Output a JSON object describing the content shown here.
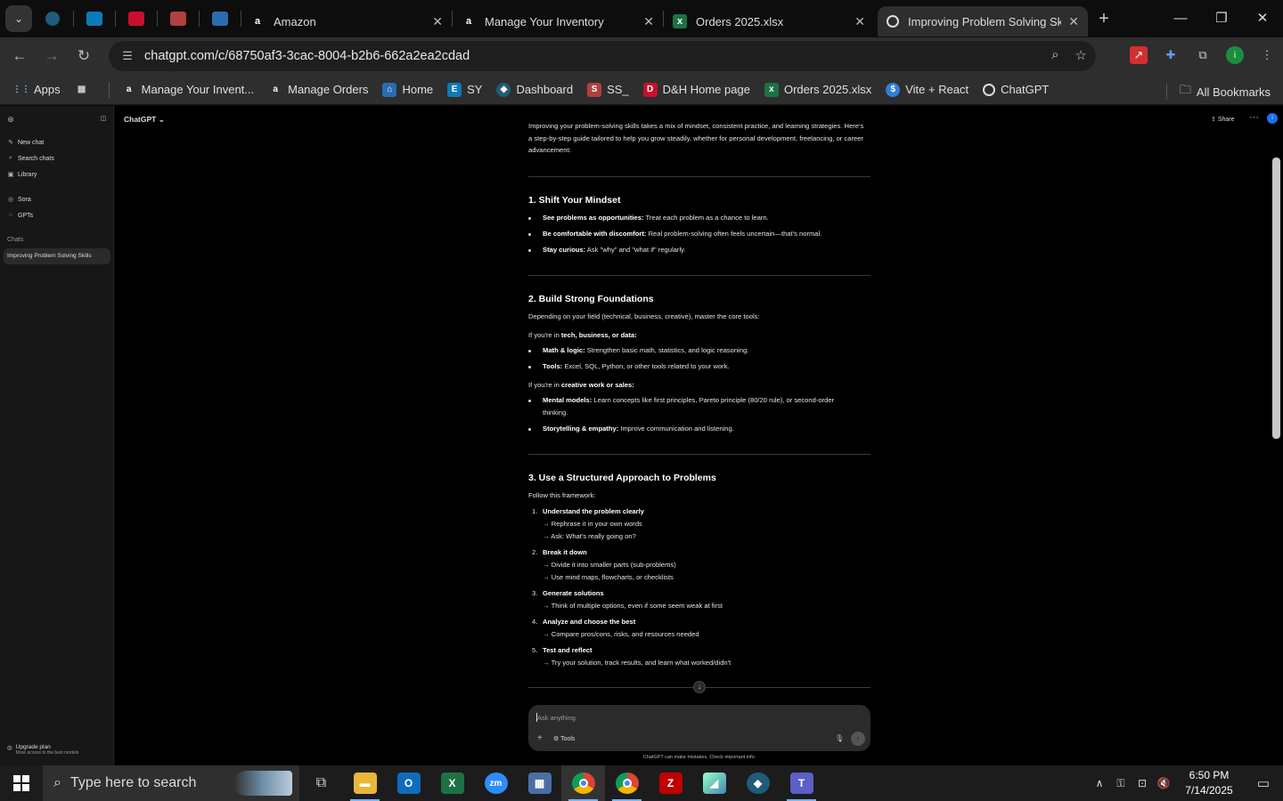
{
  "browser": {
    "tabs": [
      {
        "title": "Amazon",
        "icon": "amazon-icon"
      },
      {
        "title": "Manage Your Inventory",
        "icon": "amazon-icon"
      },
      {
        "title": "Orders 2025.xlsx",
        "icon": "excel-icon"
      },
      {
        "title": "Improving Problem Solving Skil",
        "icon": "chatgpt-icon",
        "active": true
      }
    ],
    "pinned_tabs": [
      "pinned-app-1-icon",
      "pinned-ec-icon",
      "pinned-dh-icon",
      "pinned-app-4-icon",
      "pinned-app-5-icon"
    ],
    "url": "chatgpt.com/c/68750af3-3cac-8004-b2b6-662a2ea2cdad",
    "bookmarks": [
      {
        "label": "Apps",
        "icon": "apps-grid-icon"
      },
      {
        "label": "Manage Your Invent...",
        "icon": "amazon-icon"
      },
      {
        "label": "Manage Orders",
        "icon": "amazon-icon"
      },
      {
        "label": "Home",
        "icon": "home-icon"
      },
      {
        "label": "SY",
        "icon": "ec-icon"
      },
      {
        "label": "Dashboard",
        "icon": "dashboard-icon"
      },
      {
        "label": "SS_",
        "icon": "ss-icon"
      },
      {
        "label": "D&H Home page",
        "icon": "dh-icon"
      },
      {
        "label": "Orders 2025.xlsx",
        "icon": "excel-icon"
      },
      {
        "label": "Vite + React",
        "icon": "vite-icon"
      },
      {
        "label": "ChatGPT",
        "icon": "chatgpt-icon"
      }
    ],
    "all_bookmarks": "All Bookmarks"
  },
  "sidebar": {
    "items": [
      {
        "label": "New chat",
        "icon": "new-chat-icon"
      },
      {
        "label": "Search chats",
        "icon": "search-icon"
      },
      {
        "label": "Library",
        "icon": "library-icon"
      },
      {
        "label": "Sora",
        "icon": "sora-icon"
      },
      {
        "label": "GPTs",
        "icon": "gpts-icon"
      }
    ],
    "section": "Chats",
    "chats": [
      "Improving Problem Solving Skills"
    ],
    "upgrade": {
      "title": "Upgrade plan",
      "subtitle": "More access to the best models"
    }
  },
  "header": {
    "model": "ChatGPT",
    "share": "Share"
  },
  "answer": {
    "intro": "Improving your problem-solving skills takes a mix of mindset, consistent practice, and learning strategies. Here's a step-by-step guide tailored to help you grow steadily, whether for personal development, freelancing, or career advancement:",
    "s1": {
      "heading": "1. Shift Your Mindset",
      "bullets": [
        {
          "bold": "See problems as opportunities:",
          "text": " Treat each problem as a chance to learn."
        },
        {
          "bold": "Be comfortable with discomfort:",
          "text": " Real problem-solving often feels uncertain—that's normal."
        },
        {
          "bold": "Stay curious:",
          "text": " Ask \"why\" and \"what if\" regularly."
        }
      ]
    },
    "s2": {
      "heading": "2. Build Strong Foundations",
      "intro": "Depending on your field (technical, business, creative), master the core tools:",
      "sub1_prefix": "If you're in ",
      "sub1_bold": "tech, business, or data:",
      "sub1": [
        {
          "bold": "Math & logic:",
          "text": " Strengthen basic math, statistics, and logic reasoning."
        },
        {
          "bold": "Tools:",
          "text": " Excel, SQL, Python, or other tools related to your work."
        }
      ],
      "sub2_prefix": "If you're in ",
      "sub2_bold": "creative work or sales:",
      "sub2": [
        {
          "bold": "Mental models:",
          "text": " Learn concepts like first principles, Pareto principle (80/20 rule), or second-order thinking."
        },
        {
          "bold": "Storytelling & empathy:",
          "text": " Improve communication and listening."
        }
      ]
    },
    "s3": {
      "heading": "3. Use a Structured Approach to Problems",
      "intro": "Follow this framework:",
      "steps": [
        {
          "n": "1.",
          "title": "Understand the problem clearly",
          "lines": [
            "→ Rephrase it in your own words",
            "→ Ask: What's really going on?"
          ]
        },
        {
          "n": "2.",
          "title": "Break it down",
          "lines": [
            "→ Divide it into smaller parts (sub-problems)",
            "→ Use mind maps, flowcharts, or checklists"
          ]
        },
        {
          "n": "3.",
          "title": "Generate solutions",
          "lines": [
            "→ Think of multiple options, even if some seem weak at first"
          ]
        },
        {
          "n": "4.",
          "title": "Analyze and choose the best",
          "lines": [
            "→ Compare pros/cons, risks, and resources needed"
          ]
        },
        {
          "n": "5.",
          "title": "Test and reflect",
          "lines": [
            "→ Try your solution, track results, and learn what worked/didn't"
          ]
        }
      ]
    }
  },
  "composer": {
    "placeholder": "Ask anything",
    "tools": "Tools",
    "disclaimer": "ChatGPT can make mistakes. Check important info."
  },
  "taskbar": {
    "search_placeholder": "Type here to search",
    "apps": [
      "task-view-icon",
      "file-explorer-icon",
      "outlook-icon",
      "excel-icon",
      "zoom-icon",
      "calculator-icon",
      "chrome-icon",
      "chrome-profile-icon",
      "filezilla-icon",
      "app-icon",
      "app-blue-icon",
      "teams-icon"
    ],
    "time": "6:50 PM",
    "date": "7/14/2025"
  }
}
